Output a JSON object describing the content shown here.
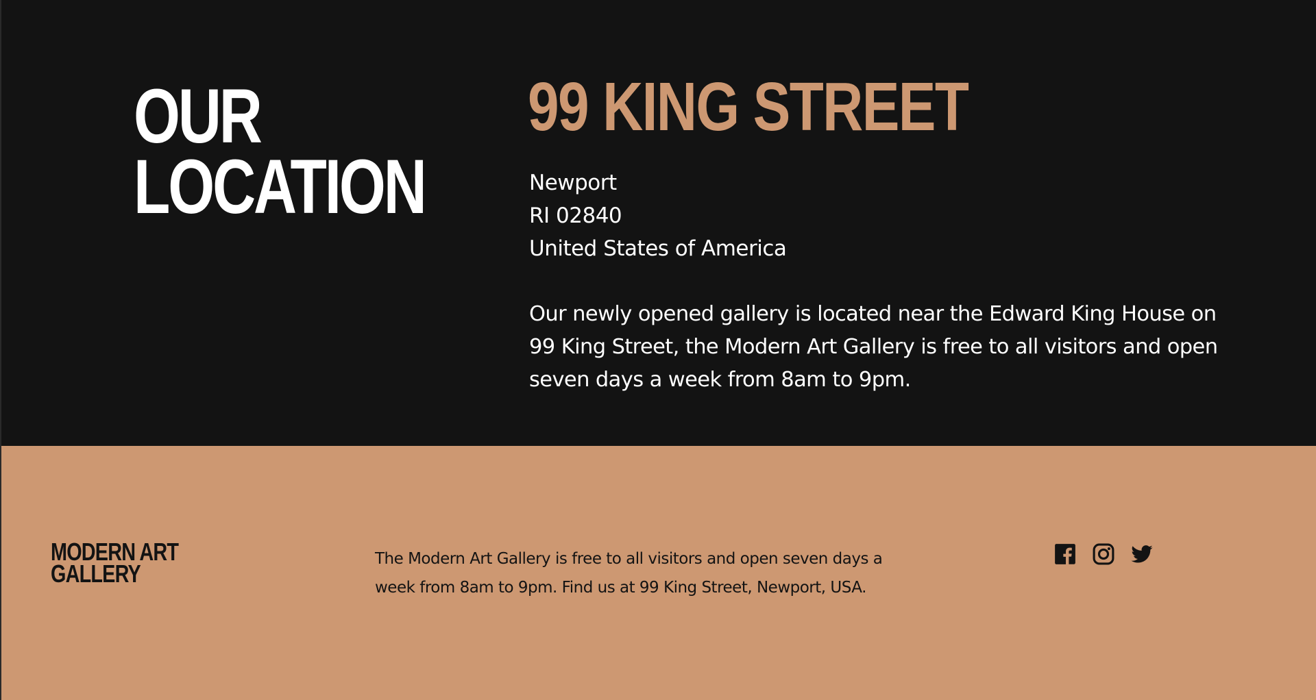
{
  "location": {
    "heading_line1": "OUR",
    "heading_line2": "LOCATION",
    "address_title": "99 KING STREET",
    "address_lines": [
      "Newport",
      "RI 02840",
      "United States of America"
    ],
    "description": "Our newly opened gallery is located near the Edward King House on 99 King Street, the Modern Art Gallery is free to all visitors and open seven days a week from 8am to 9pm."
  },
  "footer": {
    "logo_line1": "MODERN ART",
    "logo_line2": "GALLERY",
    "text": "The Modern Art Gallery is free to all visitors and open seven days a week from 8am to 9pm. Find us at 99 King Street, Newport, USA.",
    "socials": [
      {
        "name": "facebook",
        "icon": "facebook-icon"
      },
      {
        "name": "instagram",
        "icon": "instagram-icon"
      },
      {
        "name": "twitter",
        "icon": "twitter-icon"
      }
    ]
  },
  "colors": {
    "dark_background": "#131313",
    "accent": "#cd9872",
    "text_light": "#ffffff"
  }
}
